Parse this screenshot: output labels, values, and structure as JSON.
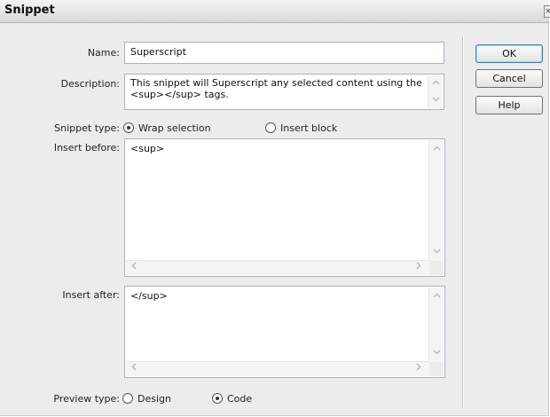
{
  "window": {
    "title": "Snippet",
    "close_glyph": "×"
  },
  "form": {
    "name_label": "Name:",
    "name_value": "Superscript",
    "description_label": "Description:",
    "description_value": "This snippet will Superscript any selected content using the <sup></sup> tags.",
    "snippet_type_label": "Snippet type:",
    "snippet_type_options": [
      "Wrap selection",
      "Insert block"
    ],
    "snippet_type_selected": "Wrap selection",
    "insert_before_label": "Insert before:",
    "insert_before_value": "<sup>",
    "insert_after_label": "Insert after:",
    "insert_after_value": "</sup>",
    "preview_type_label": "Preview type:",
    "preview_type_options": [
      "Design",
      "Code"
    ],
    "preview_type_selected": "Code"
  },
  "buttons": {
    "ok": "OK",
    "cancel": "Cancel",
    "help": "Help"
  },
  "icons": {
    "scroll_up": "chevron-up-icon",
    "scroll_down": "chevron-down-icon",
    "scroll_left": "chevron-left-icon",
    "scroll_right": "chevron-right-icon"
  }
}
